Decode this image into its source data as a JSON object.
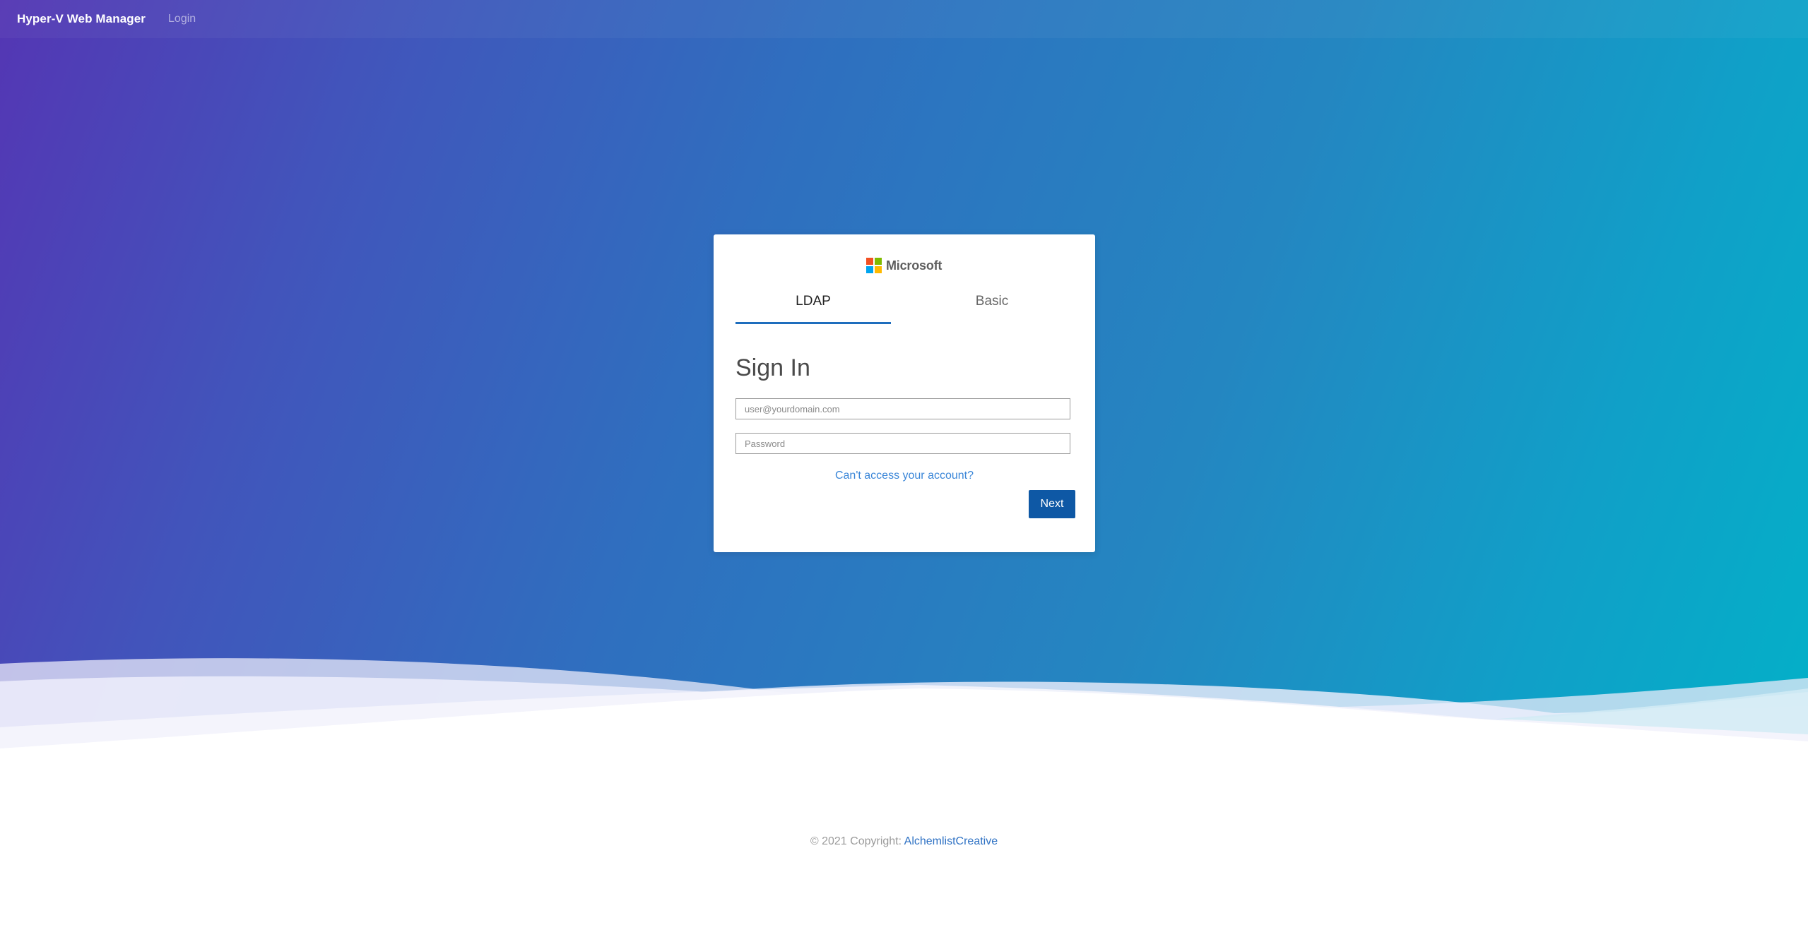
{
  "navbar": {
    "brand": "Hyper-V Web Manager",
    "login_link": "Login"
  },
  "card": {
    "logo": {
      "text": "Microsoft",
      "colors": [
        "#f25022",
        "#7fba00",
        "#00a4ef",
        "#ffb900"
      ]
    },
    "tabs": [
      {
        "label": "LDAP",
        "active": true
      },
      {
        "label": "Basic",
        "active": false
      }
    ],
    "title": "Sign In",
    "email_placeholder": "user@yourdomain.com",
    "password_placeholder": "Password",
    "forgot_link": "Can't access your account?",
    "next_label": "Next"
  },
  "footer": {
    "copyright": "© 2021 Copyright:",
    "brand_link": "AlchemlistCreative"
  },
  "theme": {
    "accent": "#1e6dbd",
    "button": "#0e58a5",
    "gradient_start": "#5436b4",
    "gradient_end": "#03b0c8"
  }
}
